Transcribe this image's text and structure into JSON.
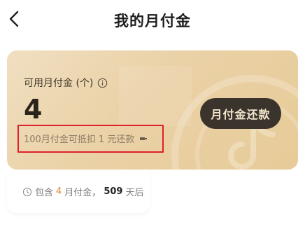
{
  "header": {
    "title": "我的月付金"
  },
  "card": {
    "label": "可用月付金 (个)",
    "value": "4",
    "note": "100月付金可抵扣 1 元还款",
    "repay_button": "月付金还款"
  },
  "info": {
    "prefix": "包含",
    "count": "4",
    "unit_text": "月付金，",
    "days": "509",
    "days_text": "天后"
  },
  "colors": {
    "card_gradient_start": "#f0dfc1",
    "card_gradient_end": "#e7cb98",
    "button_bg": "#3a342c",
    "button_text": "#f3e6cf",
    "highlight": "#e0202a",
    "accent_orange": "#e58a3a"
  },
  "icons": {
    "back": "chevron-left-icon",
    "info": "info-circle-icon",
    "clock": "clock-icon",
    "watermark": "logo-watermark"
  }
}
